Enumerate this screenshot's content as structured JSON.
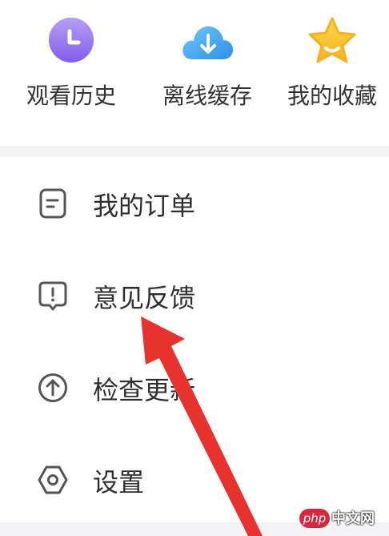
{
  "quick_actions": [
    {
      "label": "观看历史",
      "icon": "clock-icon",
      "color": "#8e6cf0"
    },
    {
      "label": "离线缓存",
      "icon": "cloud-download-icon",
      "color": "#3aa9f2"
    },
    {
      "label": "我的收藏",
      "icon": "star-icon",
      "color": "#f7c531"
    }
  ],
  "menu": [
    {
      "label": "我的订单",
      "icon": "order-icon"
    },
    {
      "label": "意见反馈",
      "icon": "feedback-icon"
    },
    {
      "label": "检查更新",
      "icon": "update-icon"
    },
    {
      "label": "设置",
      "icon": "settings-icon"
    }
  ],
  "annotation": {
    "color": "#e8322e",
    "icon": "red-arrow-icon"
  },
  "watermark": {
    "badge": "php",
    "site": "中文网"
  }
}
